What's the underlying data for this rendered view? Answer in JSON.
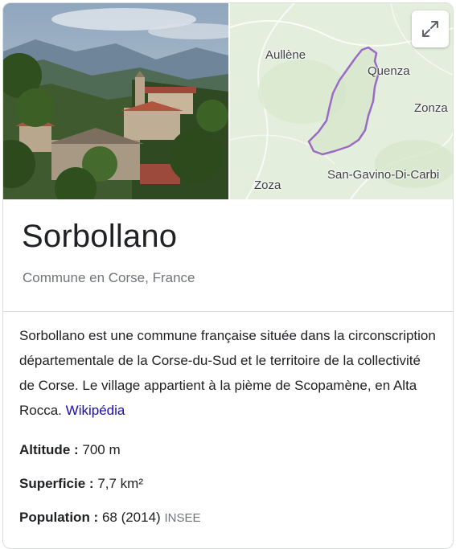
{
  "map": {
    "labels": [
      {
        "id": "aullene",
        "text": "Aullène"
      },
      {
        "id": "quenza",
        "text": "Quenza"
      },
      {
        "id": "zonza",
        "text": "Zonza"
      },
      {
        "id": "san-gavino",
        "text": "San-Gavino-Di-Carbi"
      },
      {
        "id": "zoza",
        "text": "Zoza"
      }
    ],
    "boundary_color": "#9a6bc4"
  },
  "entity": {
    "title": "Sorbollano",
    "subtitle": "Commune en Corse, France"
  },
  "description": {
    "text": "Sorbollano est une commune française située dans la circonscription départementale de la Corse-du-Sud et le territoire de la collectivité de Corse. Le village appartient à la pième de Scopamène, en Alta Rocca.",
    "source_link": "Wikipédia"
  },
  "facts": [
    {
      "label": "Altitude",
      "separator": " : ",
      "value": "700 m",
      "source": ""
    },
    {
      "label": "Superficie",
      "separator": " : ",
      "value": "7,7 km²",
      "source": ""
    },
    {
      "label": "Population",
      "separator": " : ",
      "value": "68 (2014)",
      "source": "INSEE"
    }
  ],
  "icons": {
    "expand": "expand-icon"
  }
}
